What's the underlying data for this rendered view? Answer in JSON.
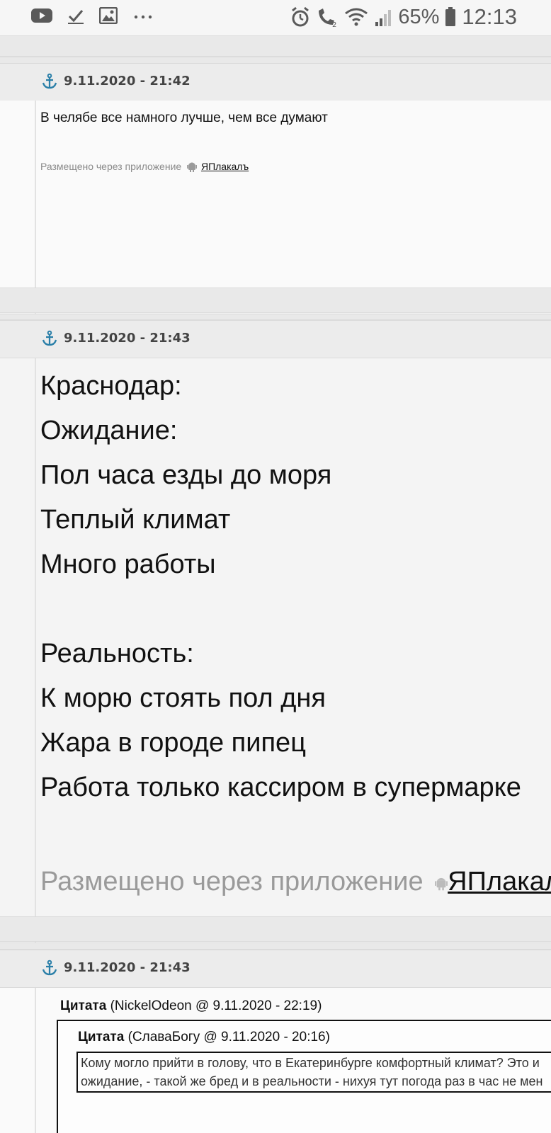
{
  "status_bar": {
    "battery": "65%",
    "time": "12:13"
  },
  "posts": [
    {
      "date": "9.11.2020 - 21:42",
      "text": "В челябе все намного лучше, чем все думают",
      "via_label": "Размещено через приложение",
      "app_name": "ЯПлакалъ"
    },
    {
      "date": "9.11.2020 - 21:43",
      "lines": [
        "Краснодар:",
        "Ожидание:",
        "Пол часа езды до моря",
        "Теплый климат",
        "Много работы",
        "",
        "Реальность:",
        "К морю стоять пол дня",
        "Жара в городе пипец",
        "Работа только кассиром в супермарке"
      ],
      "via_label": "Размещено через приложение",
      "app_name": "ЯПлакал"
    },
    {
      "date": "9.11.2020 - 21:43",
      "quote": {
        "label": "Цитата",
        "source": "(NickelOdeon @ 9.11.2020 - 22:19)",
        "inner": {
          "label": "Цитата",
          "source": "(СлаваБогу @ 9.11.2020 - 20:16)",
          "text_line1": "Кому могло прийти в голову, что в Екатеринбурге комфортный климат? Это и",
          "text_line2": "ожидание, - такой же бред и в реальности - нихуя тут погода раз в час не мен"
        }
      }
    }
  ],
  "colors": {
    "header_bg": "#ececec",
    "anchor": "#2a7fa8",
    "separator": "#e9e9e9"
  }
}
